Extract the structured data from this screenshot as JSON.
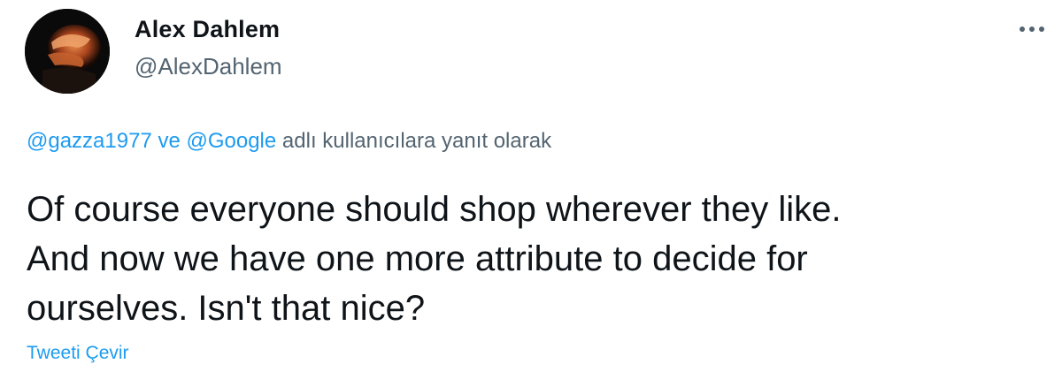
{
  "author": {
    "display_name": "Alex Dahlem",
    "handle": "@AlexDahlem",
    "avatar_icon": "user-avatar"
  },
  "more_icon": "more-horizontal-icon",
  "reply_context": {
    "mention_1": "@gazza1977",
    "connector": " ve ",
    "mention_2": "@Google",
    "suffix": " adlı kullanıcılara yanıt olarak"
  },
  "tweet": {
    "lines": [
      "Of course everyone should shop wherever they like.",
      "And now we have one more attribute to decide for",
      "ourselves. Isn't that nice?"
    ]
  },
  "translate_label": "Tweeti Çevir",
  "colors": {
    "text": "#0f1419",
    "secondary": "#536471",
    "link": "#1d9bf0"
  }
}
